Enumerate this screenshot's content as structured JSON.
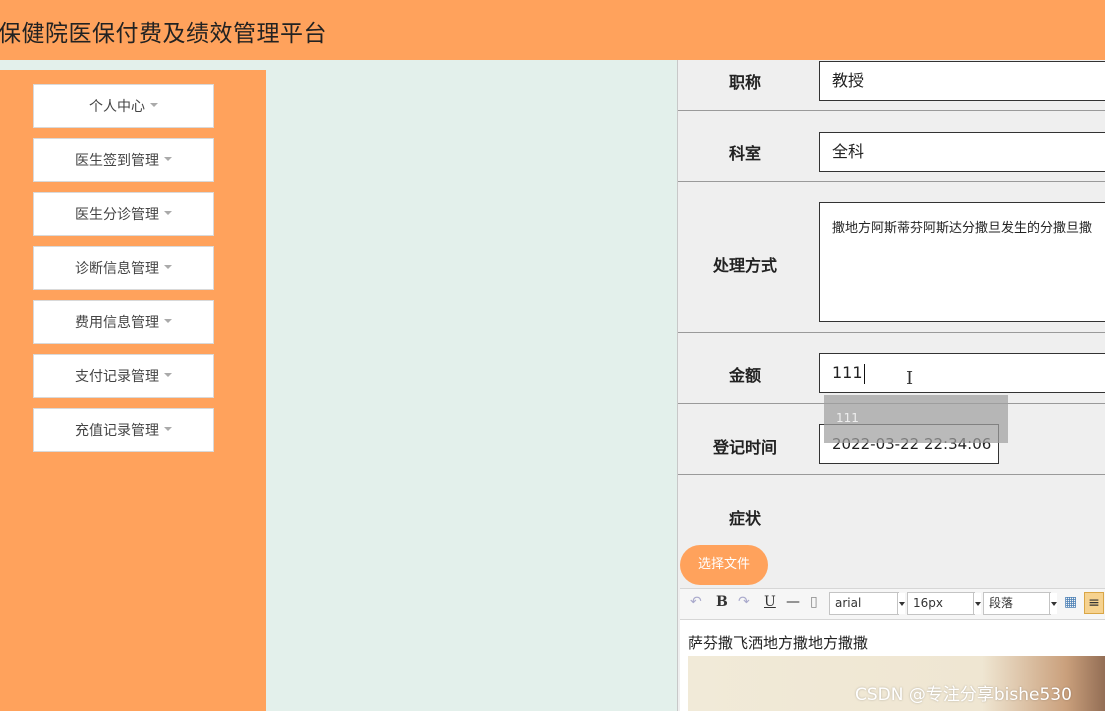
{
  "header": {
    "title": "保健院医保付费及绩效管理平台"
  },
  "sidebar": {
    "items": [
      {
        "label": "个人中心"
      },
      {
        "label": "医生签到管理"
      },
      {
        "label": "医生分诊管理"
      },
      {
        "label": "诊断信息管理"
      },
      {
        "label": "费用信息管理"
      },
      {
        "label": "支付记录管理"
      },
      {
        "label": "充值记录管理"
      }
    ]
  },
  "form": {
    "title_field": {
      "label": "职称",
      "value": "教授"
    },
    "department": {
      "label": "科室",
      "value": "全科"
    },
    "treatment": {
      "label": "处理方式",
      "value": "撒地方阿斯蒂芬阿斯达分撒旦发生的分撒旦撒"
    },
    "amount": {
      "label": "金额",
      "value": "111"
    },
    "autocomplete_suggestion": "111",
    "register_time": {
      "label": "登记时间",
      "value": "2022-03-22 22:34:06"
    },
    "symptom": {
      "label": "症状"
    },
    "file_button": "选择文件",
    "editor": {
      "toolbar": {
        "font_family": "arial",
        "font_size": "16px",
        "paragraph": "段落",
        "icons": [
          "undo-icon",
          "bold-icon",
          "redo-icon",
          "underline-icon",
          "horizontal-rule-icon",
          "document-icon",
          "table-icon",
          "align-left-icon"
        ]
      },
      "content": "萨芬撒飞洒地方撒地方撒撒"
    }
  },
  "watermark": "CSDN @专注分享bishe530",
  "colors": {
    "accent": "#ffa25c",
    "background": "#e3f0eb",
    "form_bg": "#efefef"
  }
}
